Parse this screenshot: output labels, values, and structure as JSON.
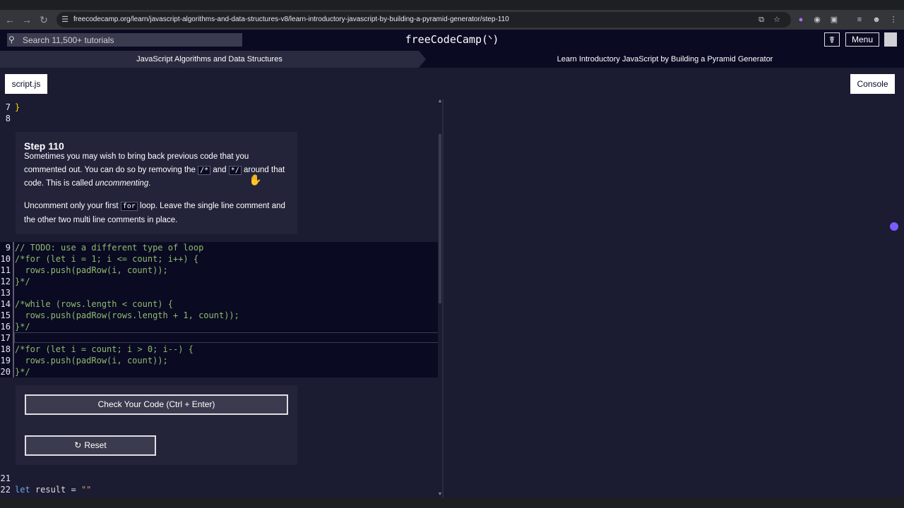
{
  "browser": {
    "url": "freecodecamp.org/learn/javascript-algorithms-and-data-structures-v8/learn-introductory-javascript-by-building-a-pyramid-generator/step-110",
    "icons": [
      "back-arrow-icon",
      "forward-arrow-icon",
      "reload-icon",
      "site-info-icon",
      "install-icon",
      "star-icon",
      "extension-icon",
      "puzzle-icon",
      "media-icon",
      "profile-icon",
      "kebab-menu-icon"
    ]
  },
  "nav": {
    "search_placeholder": "Search 11,500+ tutorials",
    "logo": "freeCodeCamp(ᐠ)",
    "menu_label": "Menu"
  },
  "breadcrumb": {
    "left": "JavaScript Algorithms and Data Structures",
    "right": "Learn Introductory JavaScript by Building a Pyramid Generator"
  },
  "toolbar": {
    "file_tab": "script.js",
    "console_tab": "Console"
  },
  "code_top": [
    {
      "n": "7",
      "text": "}"
    },
    {
      "n": "8",
      "text": ""
    }
  ],
  "code_main": [
    {
      "n": "9",
      "text": "// TODO: use a different type of loop"
    },
    {
      "n": "10",
      "text": "/*for (let i = 1; i <= count; i++) {"
    },
    {
      "n": "11",
      "text": "  rows.push(padRow(i, count));"
    },
    {
      "n": "12",
      "text": "}*/"
    },
    {
      "n": "13",
      "text": ""
    },
    {
      "n": "14",
      "text": "/*while (rows.length < count) {"
    },
    {
      "n": "15",
      "text": "  rows.push(padRow(rows.length + 1, count));"
    },
    {
      "n": "16",
      "text": "}*/"
    },
    {
      "n": "17",
      "text": ""
    },
    {
      "n": "18",
      "text": "/*for (let i = count; i > 0; i--) {"
    },
    {
      "n": "19",
      "text": "  rows.push(padRow(i, count));"
    },
    {
      "n": "20",
      "text": "}*/"
    }
  ],
  "code_bottom": [
    {
      "n": "21",
      "text": ""
    },
    {
      "n": "22",
      "kw": "let",
      "rest": " result = ",
      "str": "\"\""
    }
  ],
  "step": {
    "title": "Step 110",
    "p1_a": "Sometimes you may wish to bring back previous code that you commented out. You can do so by removing the ",
    "p1_code1": "/*",
    "p1_and": " and ",
    "p1_code2": "*/",
    "p1_b": " around that code. This is called ",
    "p1_em": "uncommenting",
    "p1_end": ".",
    "p2_a": "Uncomment only your first ",
    "p2_code": "for",
    "p2_b": " loop. Leave the single line comment and the other two multi line comments in place."
  },
  "actions": {
    "check_label": "Check Your Code (Ctrl + Enter)",
    "reset_label": "Reset"
  }
}
